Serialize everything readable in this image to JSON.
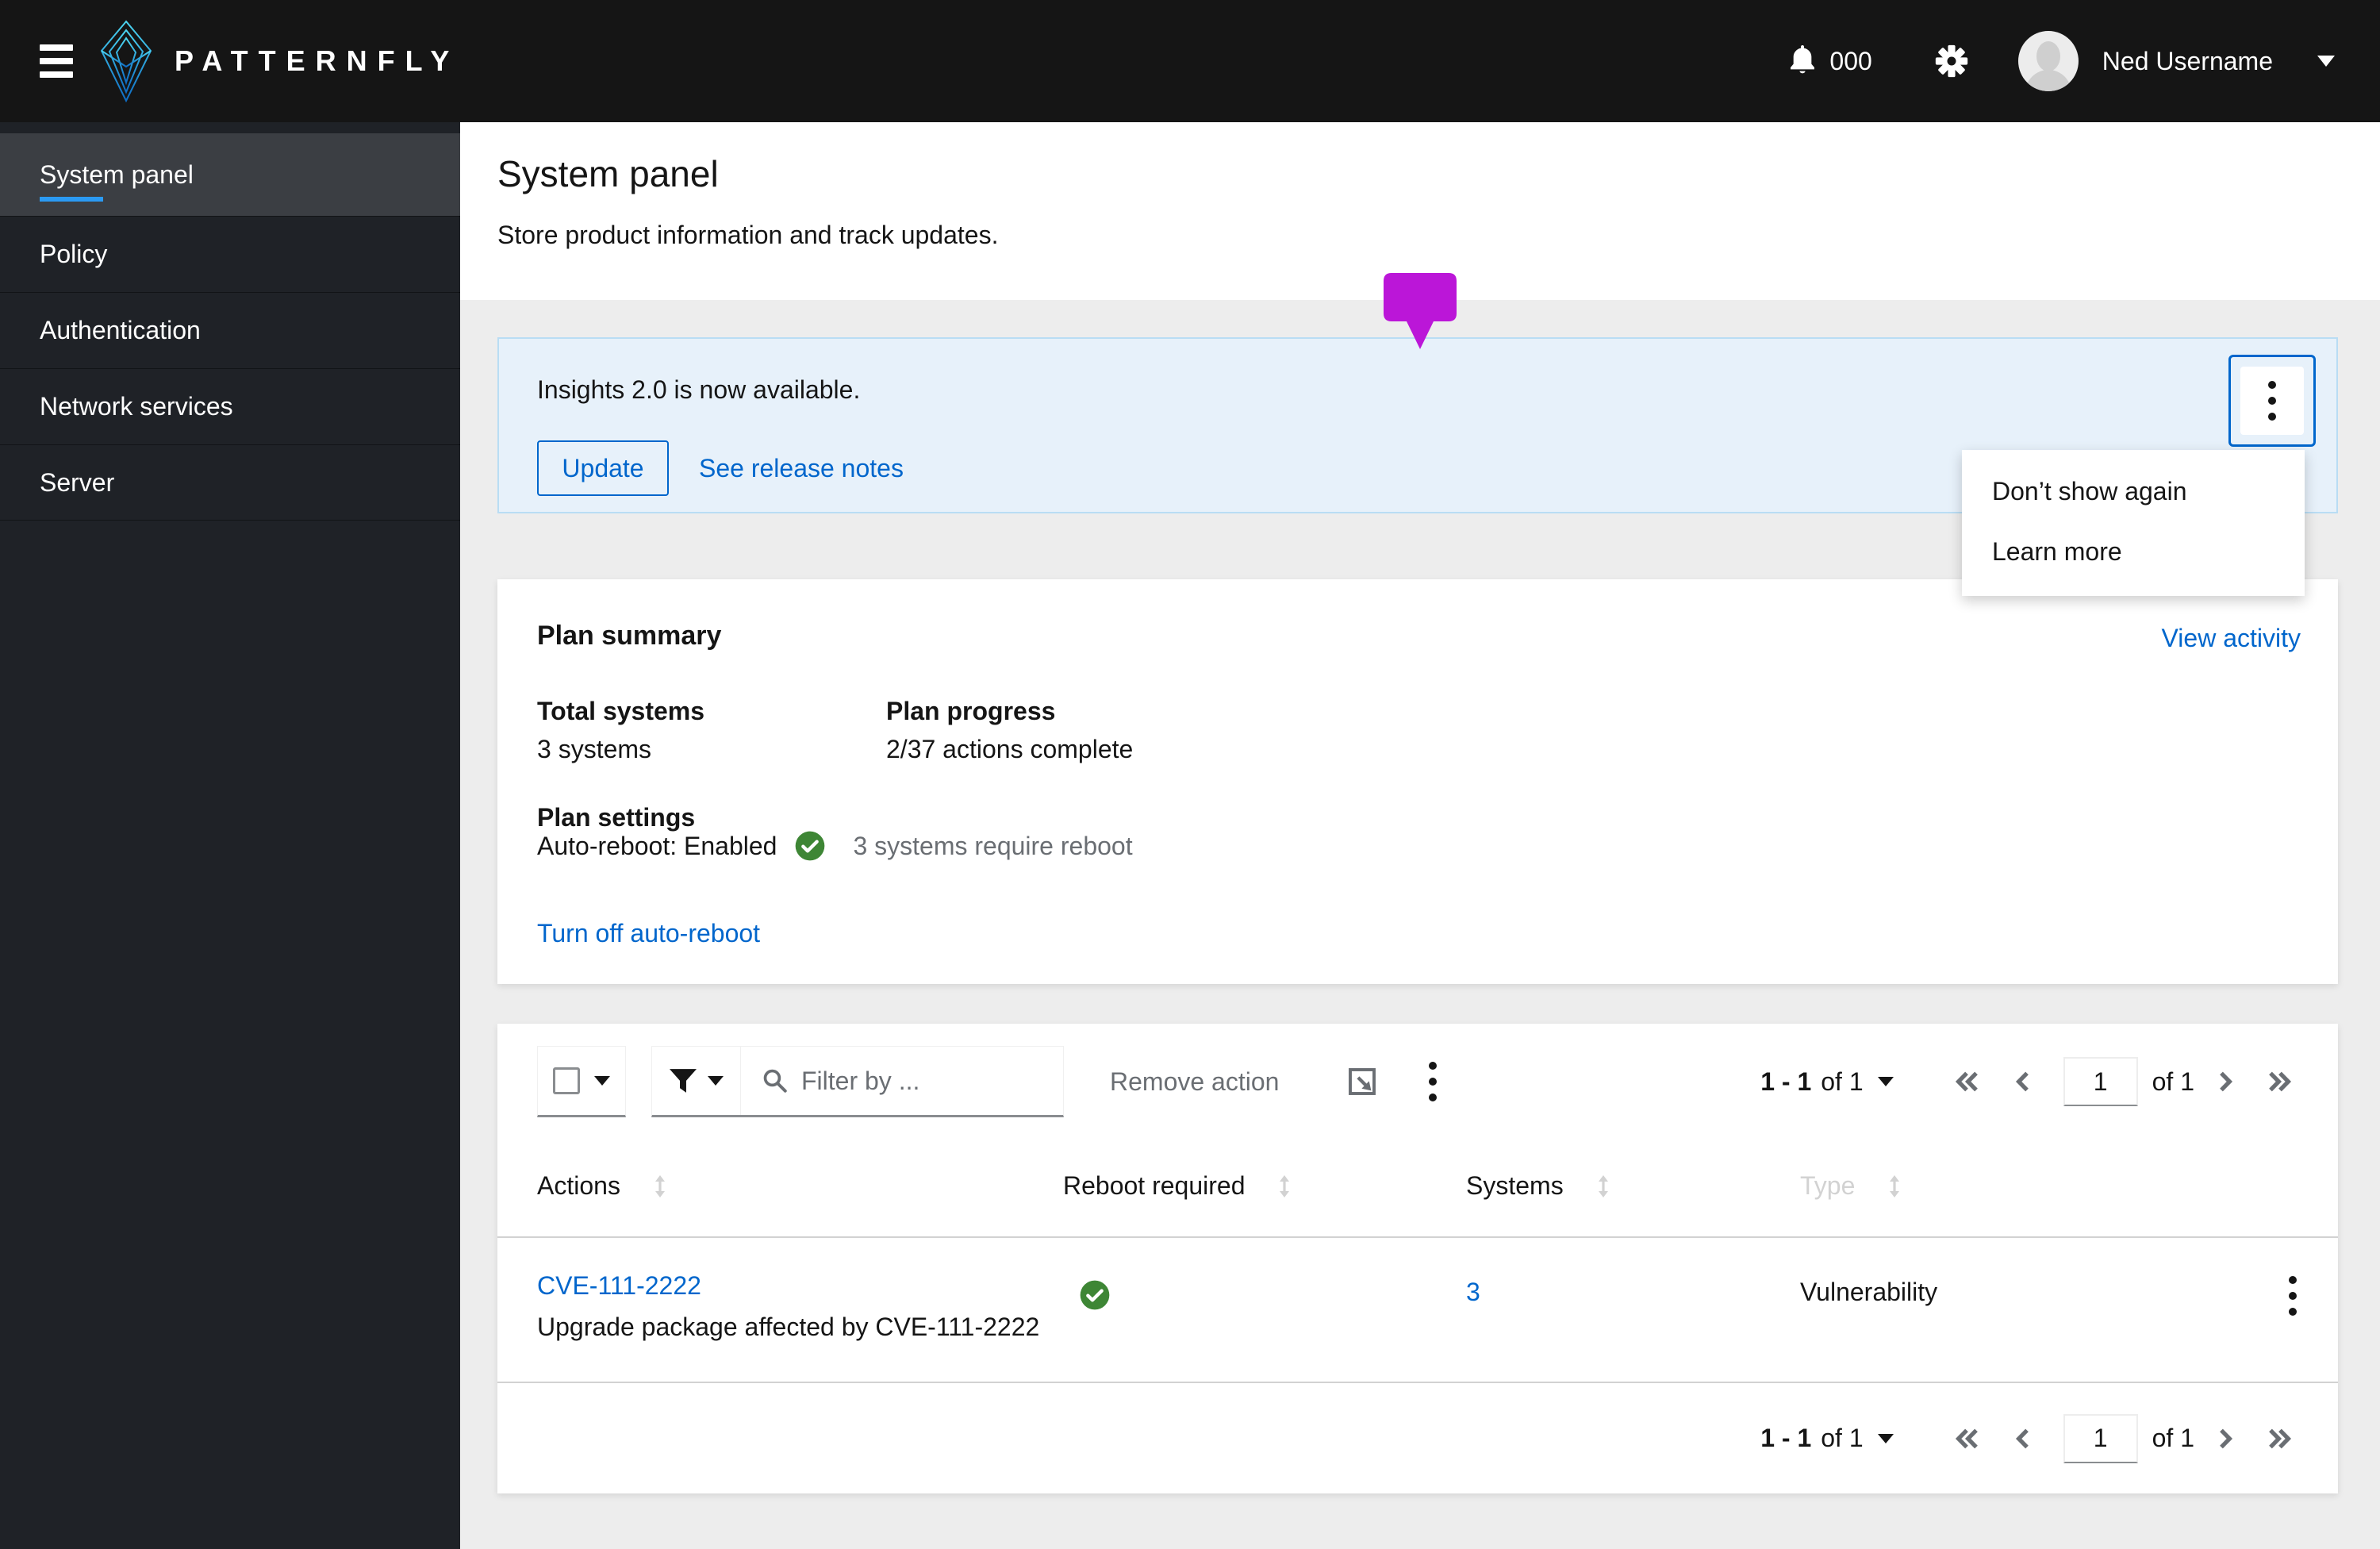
{
  "colors": {
    "accent_blue": "#0066cc",
    "success_green": "#3e8635",
    "marker_magenta": "#bb16d8",
    "masthead_bg": "#151515",
    "sidebar_bg": "#1f2227",
    "sidebar_active_bg": "#3b3e43",
    "nav_active_underline": "#2b9af3",
    "alert_bg": "#e7f1fa",
    "alert_border": "#b9ddf4",
    "page_bg": "#ededed",
    "muted_text": "#6a6e73",
    "disabled_header": "#d2d2d2"
  },
  "masthead": {
    "brand": "PATTERNFLY",
    "notification_count": "000",
    "username": "Ned Username"
  },
  "sidebar": {
    "items": [
      {
        "label": "System panel",
        "active": true
      },
      {
        "label": "Policy",
        "active": false
      },
      {
        "label": "Authentication",
        "active": false
      },
      {
        "label": "Network services",
        "active": false
      },
      {
        "label": "Server",
        "active": false
      }
    ]
  },
  "page": {
    "title": "System panel",
    "subtitle": "Store product information and track updates."
  },
  "alert": {
    "message": "Insights 2.0 is now available.",
    "update_label": "Update",
    "release_notes_label": "See release notes",
    "menu_items": [
      {
        "label": "Don’t show again"
      },
      {
        "label": "Learn more"
      }
    ]
  },
  "plan_summary": {
    "title": "Plan summary",
    "view_activity_label": "View activity",
    "total_systems_label": "Total systems",
    "total_systems_value": "3 systems",
    "plan_progress_label": "Plan progress",
    "plan_progress_value": "2/37 actions complete",
    "plan_settings_label": "Plan settings",
    "auto_reboot_status": "Auto-reboot: Enabled",
    "reboot_note": "3 systems require reboot",
    "turn_off_label": "Turn off auto-reboot"
  },
  "toolbar": {
    "filter_placeholder": "Filter by ...",
    "remove_action_label": "Remove action"
  },
  "pagination": {
    "range": "1 - 1",
    "of_range": "of 1",
    "page": "1",
    "of_pages": "of 1"
  },
  "table": {
    "columns": [
      {
        "label": "Actions"
      },
      {
        "label": "Reboot required"
      },
      {
        "label": "Systems"
      },
      {
        "label": "Type"
      }
    ],
    "rows": [
      {
        "action_id": "CVE-111-2222",
        "description": "Upgrade package affected by CVE-111-2222",
        "reboot_required": "yes",
        "systems": "3",
        "type": "Vulnerability"
      }
    ]
  }
}
